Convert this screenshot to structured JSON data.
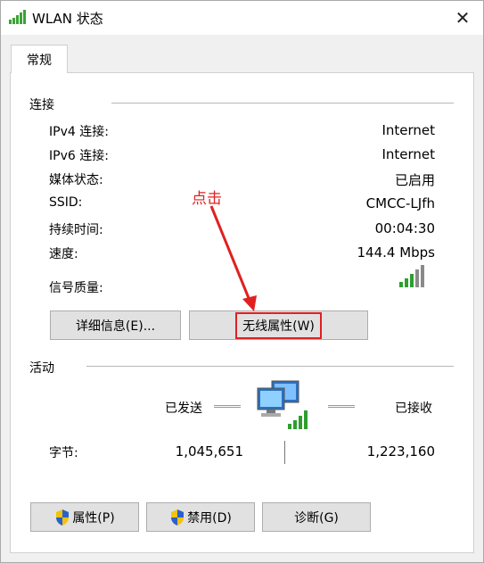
{
  "window": {
    "title": "WLAN 状态",
    "close_glyph": "✕"
  },
  "tab": {
    "label": "常规"
  },
  "connection": {
    "section_title": "连接",
    "rows": [
      {
        "label": "IPv4 连接:",
        "value": "Internet"
      },
      {
        "label": "IPv6 连接:",
        "value": "Internet"
      },
      {
        "label": "媒体状态:",
        "value": "已启用"
      },
      {
        "label": "SSID:",
        "value": "CMCC-LJfh"
      },
      {
        "label": "持续时间:",
        "value": "00:04:30"
      },
      {
        "label": "速度:",
        "value": "144.4 Mbps"
      }
    ],
    "signal_label": "信号质量:",
    "signal_icon": "signal-strength-icon",
    "details_button": "详细信息(E)...",
    "wireless_props_button": "无线属性(W)"
  },
  "annotation": {
    "text": "点击",
    "color": "#e02020"
  },
  "activity": {
    "section_title": "活动",
    "sent_label": "已发送",
    "received_label": "已接收",
    "bytes_label": "字节:",
    "bytes_sent": "1,045,651",
    "bytes_received": "1,223,160",
    "network_icon": "network-computers-icon"
  },
  "buttons": {
    "properties": "属性(P)",
    "disable": "禁用(D)",
    "diagnose": "诊断(G)"
  }
}
